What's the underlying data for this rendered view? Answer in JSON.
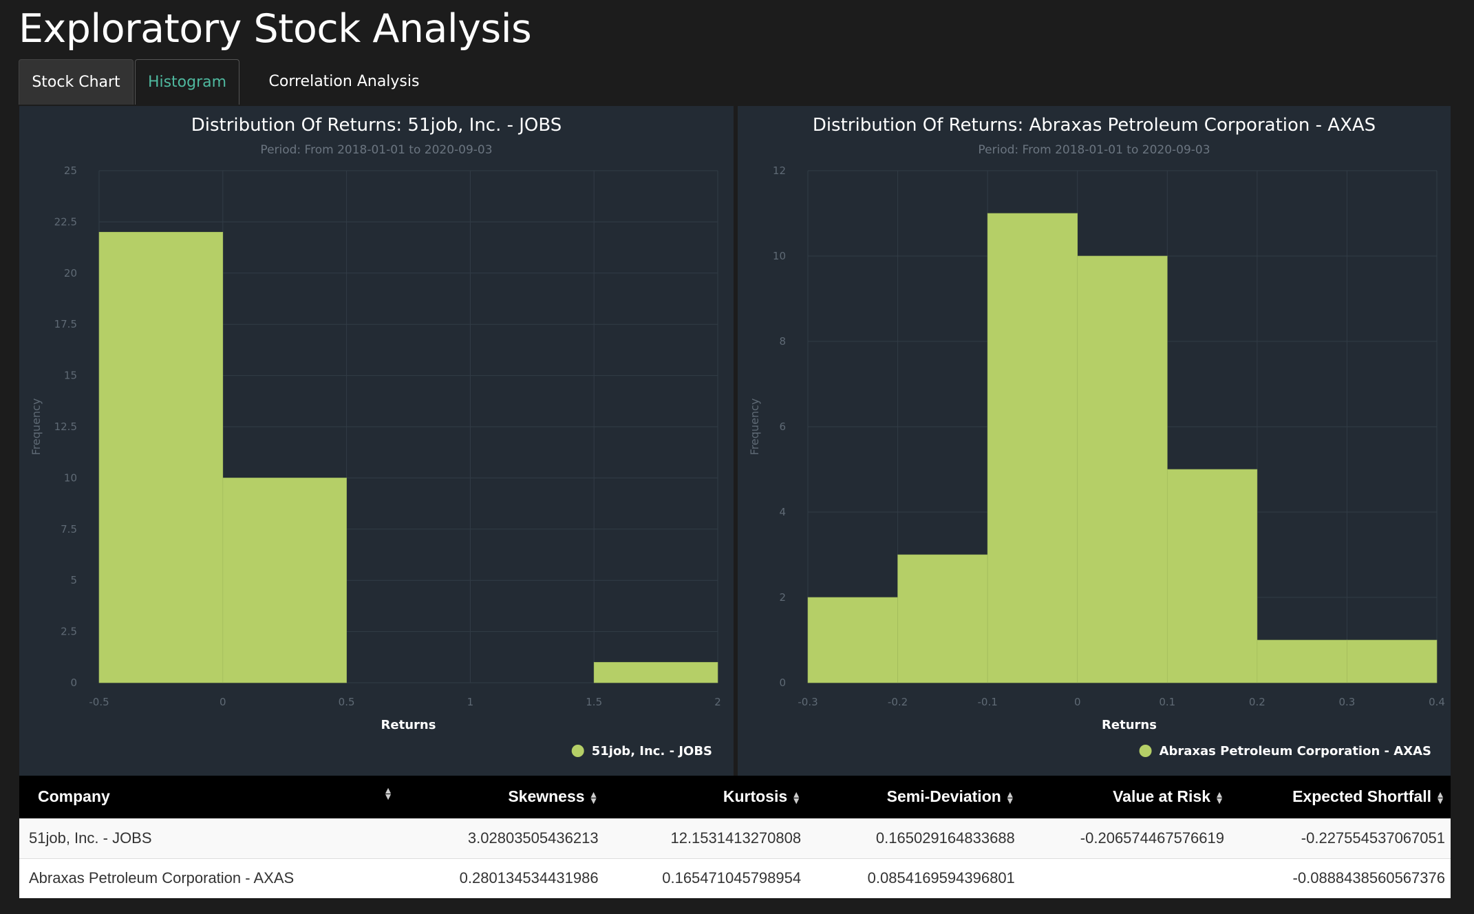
{
  "page": {
    "title": "Exploratory Stock Analysis"
  },
  "tabs": [
    {
      "label": "Stock Chart",
      "active": false
    },
    {
      "label": "Histogram",
      "active": true
    },
    {
      "label": "Correlation Analysis",
      "active": false
    }
  ],
  "colors": {
    "bar": "#b5cf67",
    "panel_bg": "#232b34",
    "active_tab": "#4fb99f"
  },
  "chart_data": [
    {
      "type": "bar",
      "title": "Distribution Of Returns: 51job, Inc. - JOBS",
      "subtitle": "Period: From 2018-01-01 to 2020-09-03",
      "xlabel": "Returns",
      "ylabel": "Frequency",
      "xlim": [
        -0.5,
        2
      ],
      "ylim": [
        0,
        25
      ],
      "xticks": [
        "-0.5",
        "0",
        "0.5",
        "1",
        "1.5",
        "2"
      ],
      "xtick_values": [
        -0.5,
        0,
        0.5,
        1,
        1.5,
        2
      ],
      "yticks": [
        "0",
        "2.5",
        "5",
        "7.5",
        "10",
        "12.5",
        "15",
        "17.5",
        "20",
        "22.5",
        "25"
      ],
      "ytick_values": [
        0,
        2.5,
        5,
        7.5,
        10,
        12.5,
        15,
        17.5,
        20,
        22.5,
        25
      ],
      "bins": [
        {
          "x0": -0.5,
          "x1": 0,
          "value": 22
        },
        {
          "x0": 0,
          "x1": 0.5,
          "value": 10
        },
        {
          "x0": 1.5,
          "x1": 2,
          "value": 1
        }
      ],
      "legend": "51job, Inc. - JOBS",
      "legend_position": "bottom-right",
      "grid": true
    },
    {
      "type": "bar",
      "title": "Distribution Of Returns: Abraxas Petroleum Corporation - AXAS",
      "subtitle": "Period: From 2018-01-01 to 2020-09-03",
      "xlabel": "Returns",
      "ylabel": "Frequency",
      "xlim": [
        -0.3,
        0.4
      ],
      "ylim": [
        0,
        12
      ],
      "xticks": [
        "-0.3",
        "-0.2",
        "-0.1",
        "0",
        "0.1",
        "0.2",
        "0.3",
        "0.4"
      ],
      "xtick_values": [
        -0.3,
        -0.2,
        -0.1,
        0,
        0.1,
        0.2,
        0.3,
        0.4
      ],
      "yticks": [
        "0",
        "2",
        "4",
        "6",
        "8",
        "10",
        "12"
      ],
      "ytick_values": [
        0,
        2,
        4,
        6,
        8,
        10,
        12
      ],
      "bins": [
        {
          "x0": -0.3,
          "x1": -0.2,
          "value": 2
        },
        {
          "x0": -0.2,
          "x1": -0.1,
          "value": 3
        },
        {
          "x0": -0.1,
          "x1": 0,
          "value": 11
        },
        {
          "x0": 0,
          "x1": 0.1,
          "value": 10
        },
        {
          "x0": 0.1,
          "x1": 0.2,
          "value": 5
        },
        {
          "x0": 0.2,
          "x1": 0.3,
          "value": 1
        },
        {
          "x0": 0.3,
          "x1": 0.4,
          "value": 1
        }
      ],
      "legend": "Abraxas Petroleum Corporation - AXAS",
      "legend_position": "bottom-right",
      "grid": true
    }
  ],
  "table": {
    "columns": [
      "Company",
      "Skewness",
      "Kurtosis",
      "Semi-Deviation",
      "Value at Risk",
      "Expected Shortfall"
    ],
    "rows": [
      [
        "51job, Inc. - JOBS",
        "3.02803505436213",
        "12.1531413270808",
        "0.165029164833688",
        "-0.206574467576619",
        "-0.227554537067051"
      ],
      [
        "Abraxas Petroleum Corporation - AXAS",
        "0.280134534431986",
        "0.165471045798954",
        "0.0854169594396801",
        "",
        "-0.0888438560567376"
      ]
    ]
  }
}
